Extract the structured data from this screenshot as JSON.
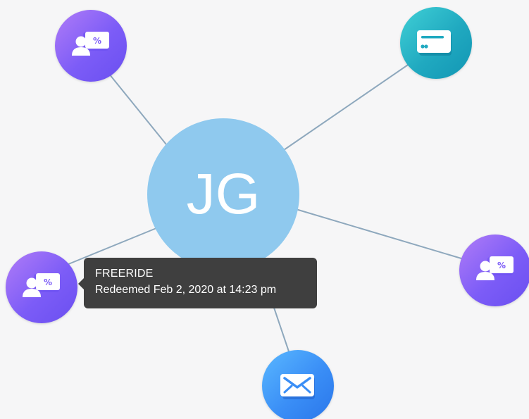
{
  "graph": {
    "center": {
      "initials": "JG",
      "color": "#8fc9ee"
    },
    "nodes": [
      {
        "id": "promo-top-left",
        "icon": "user-promo-icon"
      },
      {
        "id": "payment-card",
        "icon": "credit-card-icon"
      },
      {
        "id": "promo-right",
        "icon": "user-promo-icon"
      },
      {
        "id": "promo-left",
        "icon": "user-promo-icon"
      },
      {
        "id": "email",
        "icon": "envelope-icon"
      }
    ],
    "edge_color": "#8ea8bd"
  },
  "tooltip": {
    "title": "FREERIDE",
    "detail": "Redeemed Feb 2, 2020 at 14:23 pm"
  },
  "colors": {
    "promo": "#7c5cf7",
    "card": "#20a9c0",
    "mail": "#3a8ef6",
    "tooltip_bg": "#3f3f3f",
    "background": "#f6f6f7"
  }
}
